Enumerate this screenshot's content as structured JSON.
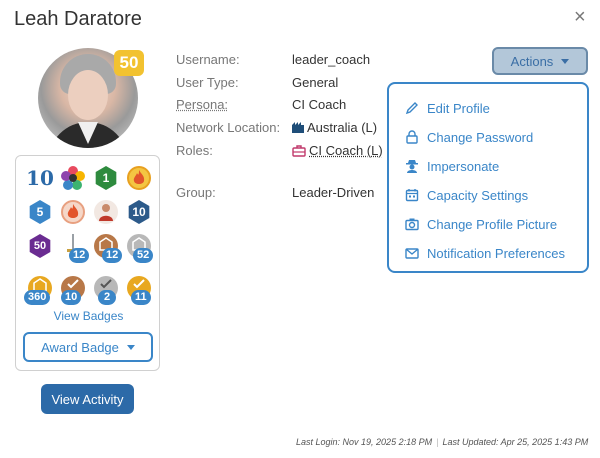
{
  "header": {
    "title": "Leah Daratore",
    "close_glyph": "×"
  },
  "profile": {
    "level": "50",
    "fields": [
      {
        "label": "Username:",
        "value": "leader_coach"
      },
      {
        "label": "User Type:",
        "value": "General"
      },
      {
        "label": "Persona:",
        "value": "CI Coach"
      },
      {
        "label": "Network Location:",
        "value": "Australia (L)"
      },
      {
        "label": "Roles:",
        "value": "CI Coach (L)"
      },
      {
        "label": "Group:",
        "value": "Leader-Driven"
      }
    ]
  },
  "badges": {
    "items": [
      {
        "icon": "ten-badge-icon",
        "center": "10",
        "count": ""
      },
      {
        "icon": "flower-badge-icon",
        "center": "",
        "count": ""
      },
      {
        "icon": "green-hex-badge-icon",
        "center": "1",
        "count": ""
      },
      {
        "icon": "flame-badge-icon",
        "center": "",
        "count": ""
      },
      {
        "icon": "blue-hex-badge-icon",
        "center": "5",
        "count": ""
      },
      {
        "icon": "flame-badge-icon",
        "center": "",
        "count": ""
      },
      {
        "icon": "person-badge-icon",
        "center": "",
        "count": ""
      },
      {
        "icon": "navy-hex-badge-icon",
        "center": "10",
        "count": ""
      },
      {
        "icon": "purple-hex-badge-icon",
        "center": "50",
        "count": ""
      },
      {
        "icon": "sword-badge-icon",
        "center": "",
        "count": "12"
      },
      {
        "icon": "bronze-medal-icon",
        "center": "",
        "count": "12"
      },
      {
        "icon": "silver-medal-icon",
        "center": "",
        "count": "52"
      },
      {
        "icon": "gold-medal-icon",
        "center": "",
        "count": "360"
      },
      {
        "icon": "bronze-check-icon",
        "center": "",
        "count": "10"
      },
      {
        "icon": "silver-check-icon",
        "center": "",
        "count": "2"
      },
      {
        "icon": "gold-check-icon",
        "center": "",
        "count": "11"
      }
    ],
    "view_label": "View Badges",
    "award_label": "Award Badge"
  },
  "view_activity_label": "View Activity",
  "actions": {
    "label": "Actions",
    "menu": [
      {
        "label": "Edit Profile",
        "icon": "pencil-icon"
      },
      {
        "label": "Change Password",
        "icon": "lock-icon"
      },
      {
        "label": "Impersonate",
        "icon": "spy-icon"
      },
      {
        "label": "Capacity Settings",
        "icon": "calendar-icon"
      },
      {
        "label": "Change Profile Picture",
        "icon": "camera-icon"
      },
      {
        "label": "Notification Preferences",
        "icon": "envelope-icon"
      }
    ]
  },
  "footer": {
    "last_login": "Last Login: Nov 19, 2025 2:18 PM",
    "separator": "|",
    "last_updated": "Last Updated: Apr 25, 2025 1:43 PM"
  },
  "colors": {
    "accent": "#3a86c8",
    "primary_button": "#2c6aa8",
    "level_badge": "#f2c230"
  }
}
